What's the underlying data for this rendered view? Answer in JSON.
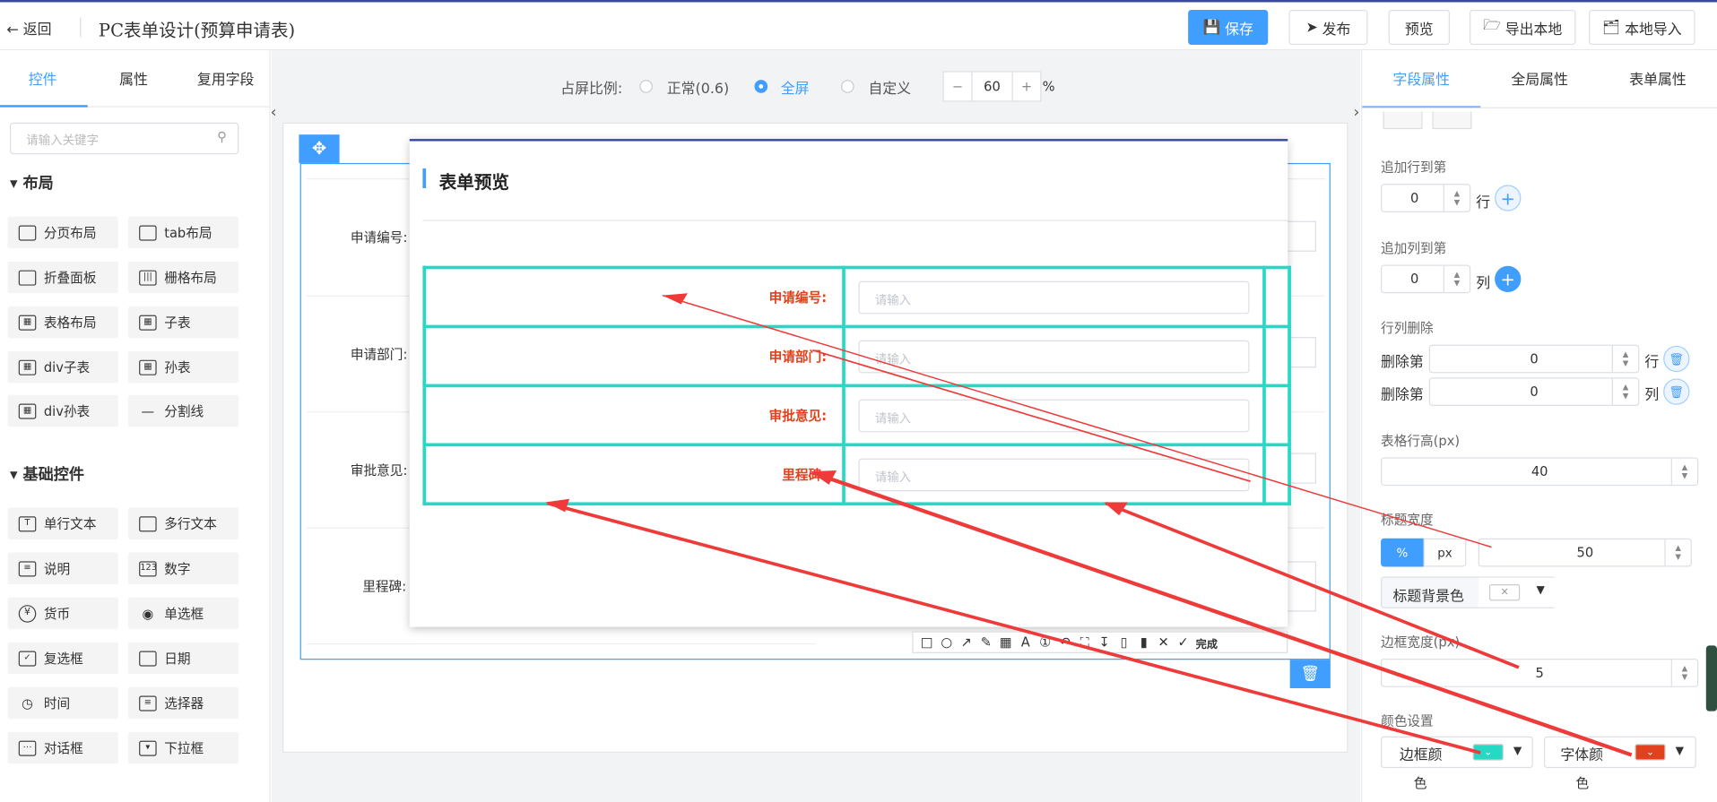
{
  "header": {
    "back_label": "返回",
    "title": "PC表单设计(预算申请表)",
    "buttons": {
      "save": "保存",
      "publish": "发布",
      "preview": "预览",
      "export": "导出本地",
      "import": "本地导入"
    }
  },
  "left": {
    "tabs": [
      "控件",
      "属性",
      "复用字段"
    ],
    "search_placeholder": "请输入关键字",
    "layout_title": "布局",
    "layout_items": [
      "分页布局",
      "tab布局",
      "折叠面板",
      "栅格布局",
      "表格布局",
      "子表",
      "div子表",
      "孙表",
      "div孙表",
      "分割线"
    ],
    "basic_title": "基础控件",
    "basic_items": [
      "单行文本",
      "多行文本",
      "说明",
      "数字",
      "货币",
      "单选框",
      "复选框",
      "日期",
      "时间",
      "选择器",
      "对话框",
      "下拉框"
    ]
  },
  "center": {
    "ratio_label": "占屏比例:",
    "ratio_options": [
      "正常(0.6)",
      "全屏",
      "自定义"
    ],
    "ratio_selected": "全屏",
    "zoom_value": "60",
    "zoom_unit": "%",
    "bg_labels": [
      "申请编号:",
      "申请部门:",
      "审批意见:",
      "里程碑:"
    ]
  },
  "preview": {
    "title": "表单预览",
    "fields": [
      {
        "label": "申请编号:",
        "placeholder": "请输入"
      },
      {
        "label": "申请部门:",
        "placeholder": "请输入"
      },
      {
        "label": "审批意见:",
        "placeholder": "请输入"
      },
      {
        "label": "里程碑:",
        "placeholder": "请输入"
      }
    ],
    "toolbar_done": "完成"
  },
  "right": {
    "tabs": [
      "字段属性",
      "全局属性",
      "表单属性"
    ],
    "add_row_label": "追加行到第",
    "add_row_value": "0",
    "row_unit": "行",
    "add_col_label": "追加列到第",
    "add_col_value": "0",
    "col_unit": "列",
    "delete_label": "行列删除",
    "delete_prefix": "删除第",
    "delete_row_value": "0",
    "delete_col_value": "0",
    "row_height_label": "表格行高(px)",
    "row_height_value": "40",
    "title_width_label": "标题宽度",
    "unit_percent": "%",
    "unit_px": "px",
    "title_width_value": "50",
    "title_bg_label": "标题背景色",
    "border_width_label": "边框宽度(px)",
    "border_width_value": "5",
    "color_label": "颜色设置",
    "border_color_label": "边框颜",
    "border_color_label2": "色",
    "font_color_label": "字体颜",
    "font_color_label2": "色",
    "border_color": "#25d9c5",
    "font_color": "#e2411e",
    "accent": "#409eff"
  }
}
